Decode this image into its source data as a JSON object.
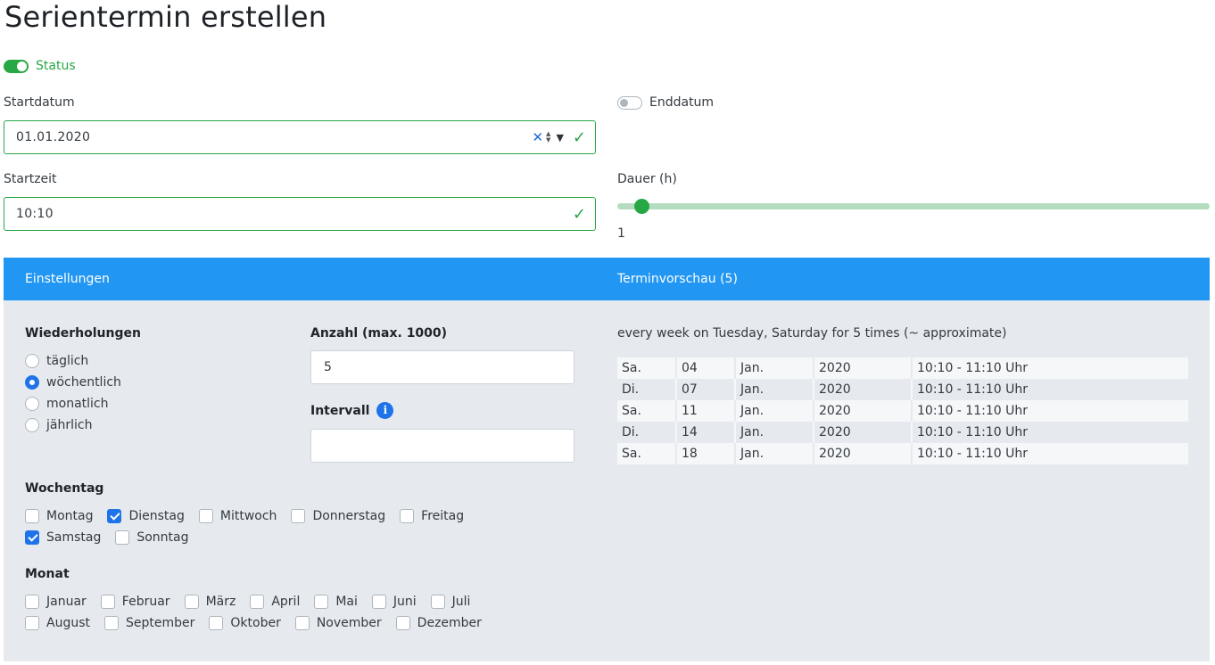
{
  "page": {
    "title": "Serientermin erstellen"
  },
  "status": {
    "label": "Status",
    "on": true
  },
  "start_date": {
    "label": "Startdatum",
    "value": "01.01.2020"
  },
  "end_date": {
    "label": "Enddatum",
    "on": false
  },
  "start_time": {
    "label": "Startzeit",
    "value": "10:10"
  },
  "duration": {
    "label": "Dauer (h)",
    "value": "1"
  },
  "panel": {
    "settings_title": "Einstellungen",
    "preview_title": "Terminvorschau (5)"
  },
  "repeat": {
    "title": "Wiederholungen",
    "options": [
      {
        "label": "täglich",
        "selected": false
      },
      {
        "label": "wöchentlich",
        "selected": true
      },
      {
        "label": "monatlich",
        "selected": false
      },
      {
        "label": "jährlich",
        "selected": false
      }
    ]
  },
  "count": {
    "label": "Anzahl (max. 1000)",
    "value": "5"
  },
  "interval": {
    "label": "Intervall",
    "value": ""
  },
  "weekday": {
    "title": "Wochentag",
    "days": [
      {
        "label": "Montag",
        "checked": false
      },
      {
        "label": "Dienstag",
        "checked": true
      },
      {
        "label": "Mittwoch",
        "checked": false
      },
      {
        "label": "Donnerstag",
        "checked": false
      },
      {
        "label": "Freitag",
        "checked": false
      },
      {
        "label": "Samstag",
        "checked": true
      },
      {
        "label": "Sonntag",
        "checked": false
      }
    ]
  },
  "month": {
    "title": "Monat",
    "months": [
      {
        "label": "Januar",
        "checked": false
      },
      {
        "label": "Februar",
        "checked": false
      },
      {
        "label": "März",
        "checked": false
      },
      {
        "label": "April",
        "checked": false
      },
      {
        "label": "Mai",
        "checked": false
      },
      {
        "label": "Juni",
        "checked": false
      },
      {
        "label": "Juli",
        "checked": false
      },
      {
        "label": "August",
        "checked": false
      },
      {
        "label": "September",
        "checked": false
      },
      {
        "label": "Oktober",
        "checked": false
      },
      {
        "label": "November",
        "checked": false
      },
      {
        "label": "Dezember",
        "checked": false
      }
    ]
  },
  "preview": {
    "summary": "every week on Tuesday, Saturday for 5 times (~ approximate)",
    "rows": [
      [
        "Sa.",
        "04",
        "Jan.",
        "2020",
        "10:10 - 11:10 Uhr"
      ],
      [
        "Di.",
        "07",
        "Jan.",
        "2020",
        "10:10 - 11:10 Uhr"
      ],
      [
        "Sa.",
        "11",
        "Jan.",
        "2020",
        "10:10 - 11:10 Uhr"
      ],
      [
        "Di.",
        "14",
        "Jan.",
        "2020",
        "10:10 - 11:10 Uhr"
      ],
      [
        "Sa.",
        "18",
        "Jan.",
        "2020",
        "10:10 - 11:10 Uhr"
      ]
    ]
  },
  "colors": {
    "accent": "#28a745",
    "panel_header": "#2196f3",
    "panel_bg": "#e6eaef",
    "check_blue": "#1e73e8"
  }
}
